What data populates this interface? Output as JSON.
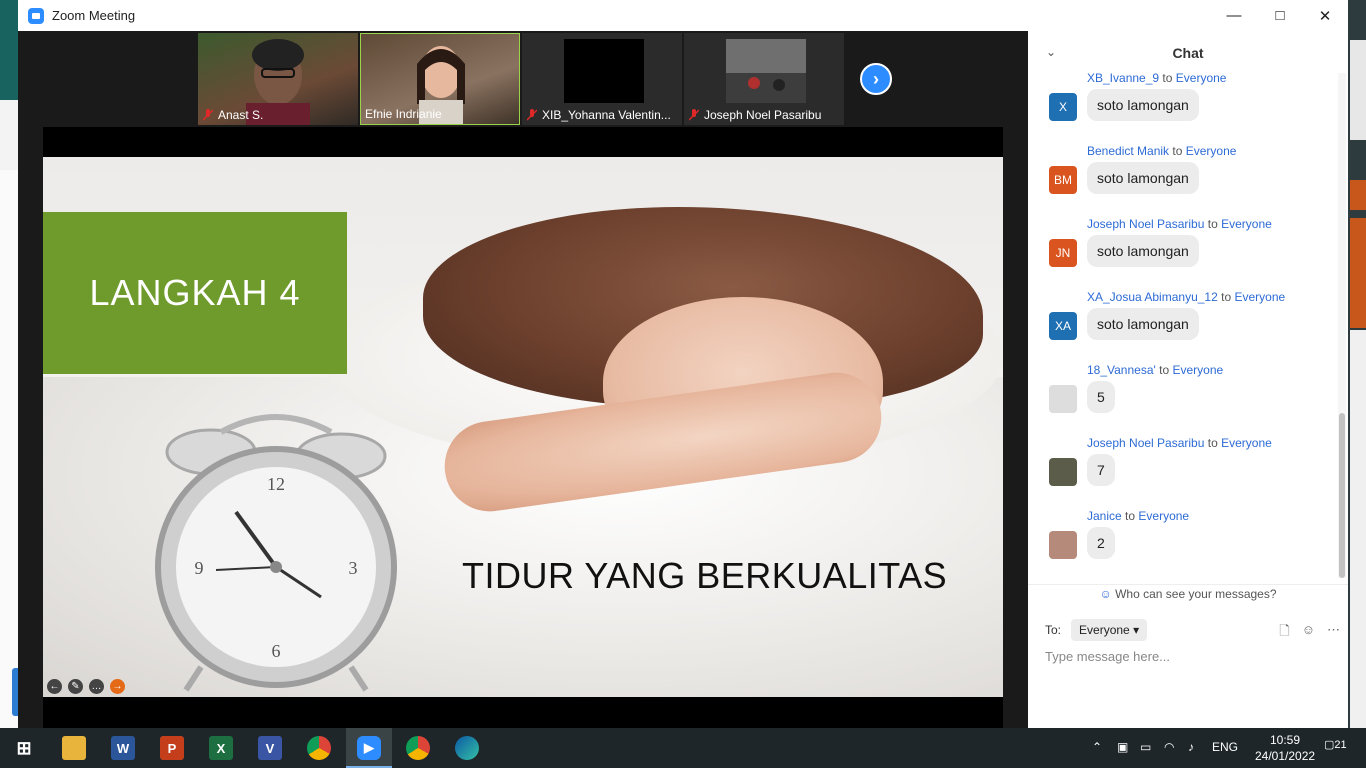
{
  "window": {
    "title": "Zoom Meeting"
  },
  "participants": [
    {
      "name": "Anast S.",
      "muted": true,
      "active": false
    },
    {
      "name": "Efnie Indrianie",
      "muted": false,
      "active": true
    },
    {
      "name": "XIB_Yohanna Valentin...",
      "muted": true,
      "active": false
    },
    {
      "name": "Joseph Noel Pasaribu",
      "muted": true,
      "active": false
    }
  ],
  "slide": {
    "heading": "LANGKAH 4",
    "subtitle": "TIDUR YANG BERKUALITAS"
  },
  "chat": {
    "title": "Chat",
    "to_label": "to",
    "messages": [
      {
        "sender": "XB_Ivanne_9",
        "recipient": "Everyone",
        "text": "soto lamongan",
        "avatar": "X",
        "avatar_color": "#1f6fb3"
      },
      {
        "sender": "Benedict Manik",
        "recipient": "Everyone",
        "text": "soto lamongan",
        "avatar": "BM",
        "avatar_color": "#d9541e"
      },
      {
        "sender": "Joseph Noel Pasaribu",
        "recipient": "Everyone",
        "text": "soto lamongan",
        "avatar": "JN",
        "avatar_color": "#d9541e"
      },
      {
        "sender": "XA_Josua Abimanyu_12",
        "recipient": "Everyone",
        "text": "soto lamongan",
        "avatar": "XA",
        "avatar_color": "#1f6fb3"
      },
      {
        "sender": "18_Vannesa'",
        "recipient": "Everyone",
        "text": "5",
        "avatar": "",
        "avatar_color": "#dddddd"
      },
      {
        "sender": "Joseph Noel Pasaribu",
        "recipient": "Everyone",
        "text": "7",
        "avatar": "",
        "avatar_color": "#5c5c4a"
      },
      {
        "sender": "Janice",
        "recipient": "Everyone",
        "text": "2",
        "avatar": "",
        "avatar_color": "#b58a7a"
      }
    ],
    "who_can_see": "Who can see your messages?",
    "to_field_label": "To:",
    "to_value": "Everyone",
    "input_placeholder": "Type message here..."
  },
  "taskbar": {
    "lang": "ENG",
    "time": "10:59",
    "date": "24/01/2022",
    "notifications": "21"
  }
}
